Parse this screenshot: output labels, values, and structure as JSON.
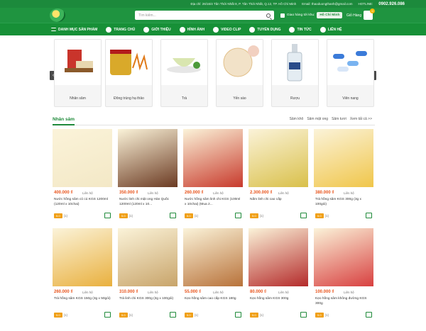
{
  "topbar": {
    "address": "Địa chỉ: 26/16/4 Tân Thới Nhất 8, P. Tân Thới Nhất, Q.12, TP. Hồ Chí Minh",
    "email": "Email: thaoduongthanh@gmail.com",
    "hotline_label": "HOTLINE:",
    "hotline": "0902.926.086"
  },
  "header": {
    "search_placeholder": "Tìm kiếm...",
    "delivery_label": "Giao hàng tới khu:",
    "delivery_city": "Hồ Chí Minh",
    "cart_label": "Giỏ Hàng",
    "cart_count": "0"
  },
  "nav": {
    "items": [
      "DANH MỤC SẢN PHẨM",
      "TRANG CHỦ",
      "GIỚI THIỆU",
      "HÌNH ẢNH",
      "VIDEO CLIP",
      "TUYỂN DỤNG",
      "TIN TỨC",
      "LIÊN HỆ"
    ]
  },
  "categories": [
    "Nhân sâm",
    "Đông trùng hạ thảo",
    "Trà",
    "Yến sào",
    "Rượu",
    "Viên nang"
  ],
  "section": {
    "title": "Nhân sâm",
    "links": [
      "Sâm khô",
      "Sâm mật ong",
      "Sâm tươi",
      "Xem tất cả >>"
    ]
  },
  "products": [
    {
      "price": "400.000 ₫",
      "contact": "Liên hệ",
      "name": "Nước hồng sâm có củ KGS 1200ml (120ml x 10chai)",
      "rate": "5.0",
      "count": "(1)",
      "color": "#f3e8c6"
    },
    {
      "price": "350.000 ₫",
      "contact": "Liên hệ",
      "name": "Nước linh chi mật ong Hàn Quốc 1200ml (120ml x 10...",
      "rate": "5.0",
      "count": "(1)",
      "color": "#6b3a22"
    },
    {
      "price": "260.000 ₫",
      "contact": "Liên hệ",
      "name": "Nước hồng sâm linh chi KGS (100ml x 10chai) (Mua 2...",
      "rate": "5.0",
      "count": "(1)",
      "color": "#c83a2c"
    },
    {
      "price": "2.300.000 ₫",
      "contact": "Liên hệ",
      "name": "Nấm linh chi cao cấp",
      "rate": "5.0",
      "count": "(1)",
      "color": "#d9c04a"
    },
    {
      "price": "380.000 ₫",
      "contact": "Liên hệ",
      "name": "Trà hồng sâm KGS 300g (3g x 100gói)",
      "rate": "5.0",
      "count": "(1)",
      "color": "#f0c64a"
    },
    {
      "price": "260.000 ₫",
      "contact": "Liên hệ",
      "name": "Trà hồng sâm KGS 150g (3g x 50gói)",
      "rate": "5.0",
      "count": "(1)",
      "color": "#e9b03e"
    },
    {
      "price": "310.000 ₫",
      "contact": "Liên hệ",
      "name": "Trà linh chi KGS 300g (3g x 100gói)",
      "rate": "5.0",
      "count": "(1)",
      "color": "#c8a46a"
    },
    {
      "price": "55.000 ₫",
      "contact": "Liên hệ",
      "name": "Kẹo hồng sâm cao cấp KGS 180g",
      "rate": "5.0",
      "count": "(1)",
      "color": "#b8723a"
    },
    {
      "price": "80.000 ₫",
      "contact": "Liên hệ",
      "name": "Kẹo hồng sâm KGS 300g",
      "rate": "5.0",
      "count": "(1)",
      "color": "#b42a2a"
    },
    {
      "price": "100.000 ₫",
      "contact": "Liên hệ",
      "name": "Kẹo hồng sâm không đường KGS 300g",
      "rate": "5.0",
      "count": "(1)",
      "color": "#d84040"
    }
  ]
}
